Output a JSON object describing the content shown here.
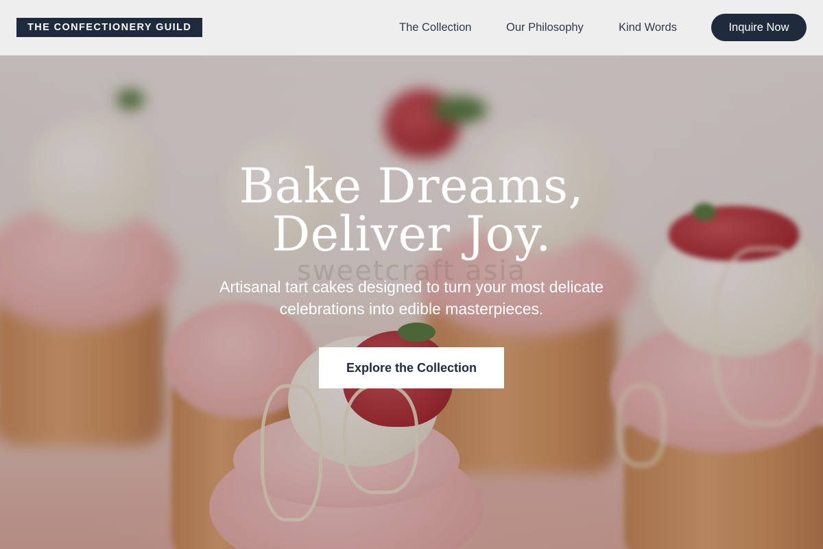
{
  "header": {
    "brand": "THE CONFECTIONERY GUILD",
    "nav": [
      {
        "label": "The Collection"
      },
      {
        "label": "Our Philosophy"
      },
      {
        "label": "Kind Words"
      }
    ],
    "cta_label": "Inquire Now"
  },
  "hero": {
    "headline_line1": "Bake Dreams,",
    "headline_line2": "Deliver Joy.",
    "subtitle_line1": "Artisanal tart cakes designed to turn your most delicate",
    "subtitle_line2": "celebrations into edible masterpieces.",
    "button_label": "Explore the Collection",
    "watermark": "sweetcraft asia",
    "background_image": "pink-frosted-cupcakes-with-strawberries-photo"
  },
  "colors": {
    "navy": "#1f2a3c",
    "header_bg": "#f0f0f0",
    "frosting_pink": "#efb9b6",
    "white": "#ffffff"
  }
}
